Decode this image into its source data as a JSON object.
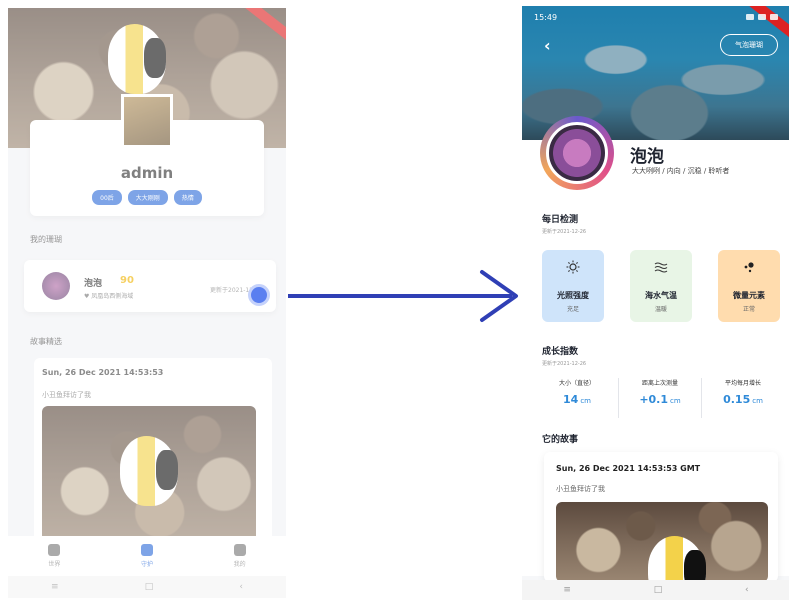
{
  "left_screen": {
    "profile": {
      "name": "admin",
      "tags": [
        "00后",
        "大大刚刚",
        "热情"
      ]
    },
    "my_tank_section": "我的珊瑚",
    "item": {
      "name": "泡泡",
      "score": "90",
      "location": "♥ 凤凰岛西侧海域",
      "updated": "更新于2021-12-26"
    },
    "story_section": "故事精选",
    "story": {
      "date": "Sun, 26 Dec 2021 14:53:53",
      "text": "小丑鱼拜访了我"
    },
    "tabs": [
      "世界",
      "守护",
      "我的"
    ],
    "nav": [
      "≡",
      "□",
      "‹"
    ]
  },
  "right_screen": {
    "status": {
      "time": "15:49"
    },
    "back": "‹",
    "bubble_button": "气泡珊瑚",
    "name": "泡泡",
    "tags": "大大咧咧 / 内向 / 沉稳 / 聆听者",
    "daily": {
      "title": "每日检测",
      "updated": "更新于2021-12-26",
      "metrics": [
        {
          "label": "光照强度",
          "status": "充足",
          "icon": "sun-icon"
        },
        {
          "label": "海水气温",
          "status": "温暖",
          "icon": "waves-icon"
        },
        {
          "label": "微量元素",
          "status": "正常",
          "icon": "dots-icon"
        }
      ]
    },
    "growth": {
      "title": "成长指数",
      "updated": "更新于2021-12-26",
      "items": [
        {
          "label": "大小（直径）",
          "value": "14",
          "unit": "cm"
        },
        {
          "label": "距离上次测量",
          "value": "+0.1",
          "unit": "cm"
        },
        {
          "label": "平均每月增长",
          "value": "0.15",
          "unit": "cm"
        }
      ]
    },
    "story_title": "它的故事",
    "story": {
      "date": "Sun, 26 Dec 2021 14:53:53 GMT",
      "text": "小丑鱼拜访了我"
    },
    "nav": [
      "≡",
      "□",
      "‹"
    ]
  },
  "colors": {
    "accent_blue": "#2f6dd8",
    "value_blue": "#2f8ad8",
    "score_gold": "#f0b400",
    "arrow": "#2f3fb5"
  }
}
